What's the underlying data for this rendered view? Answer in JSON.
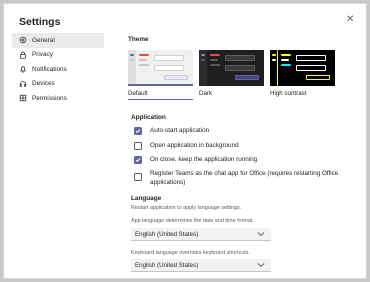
{
  "dialog": {
    "title": "Settings",
    "close_glyph": "✕"
  },
  "nav": [
    {
      "label": "General",
      "icon": "gear-icon",
      "active": true
    },
    {
      "label": "Privacy",
      "icon": "lock-icon",
      "active": false
    },
    {
      "label": "Notifications",
      "icon": "bell-icon",
      "active": false
    },
    {
      "label": "Devices",
      "icon": "headset-icon",
      "active": false
    },
    {
      "label": "Permissions",
      "icon": "grid-icon",
      "active": false
    }
  ],
  "theme": {
    "title": "Theme",
    "options": [
      {
        "label": "Default",
        "selected": true
      },
      {
        "label": "Dark",
        "selected": false
      },
      {
        "label": "High contrast",
        "selected": false
      }
    ]
  },
  "application": {
    "title": "Application",
    "options": [
      {
        "label": "Auto-start application",
        "checked": true
      },
      {
        "label": "Open application in background",
        "checked": false
      },
      {
        "label": "On close, keep the application running",
        "checked": true
      },
      {
        "label": "Register Teams as the chat app for Office (requires restarting Office applications)",
        "checked": false
      }
    ]
  },
  "language": {
    "title": "Language",
    "restart_note": "Restart application to apply language settings.",
    "app_lang_note": "App language determines the date and time format.",
    "app_lang_value": "English (United States)",
    "keyboard_note": "Keyboard language overrides keyboard shortcuts.",
    "keyboard_value": "English (United States)"
  },
  "colors": {
    "accent": "#6264a7",
    "dark_bg": "#1f1f1f",
    "hc_bg": "#000000",
    "hc_yellow": "#ffff01",
    "hc_cyan": "#00ebff"
  }
}
